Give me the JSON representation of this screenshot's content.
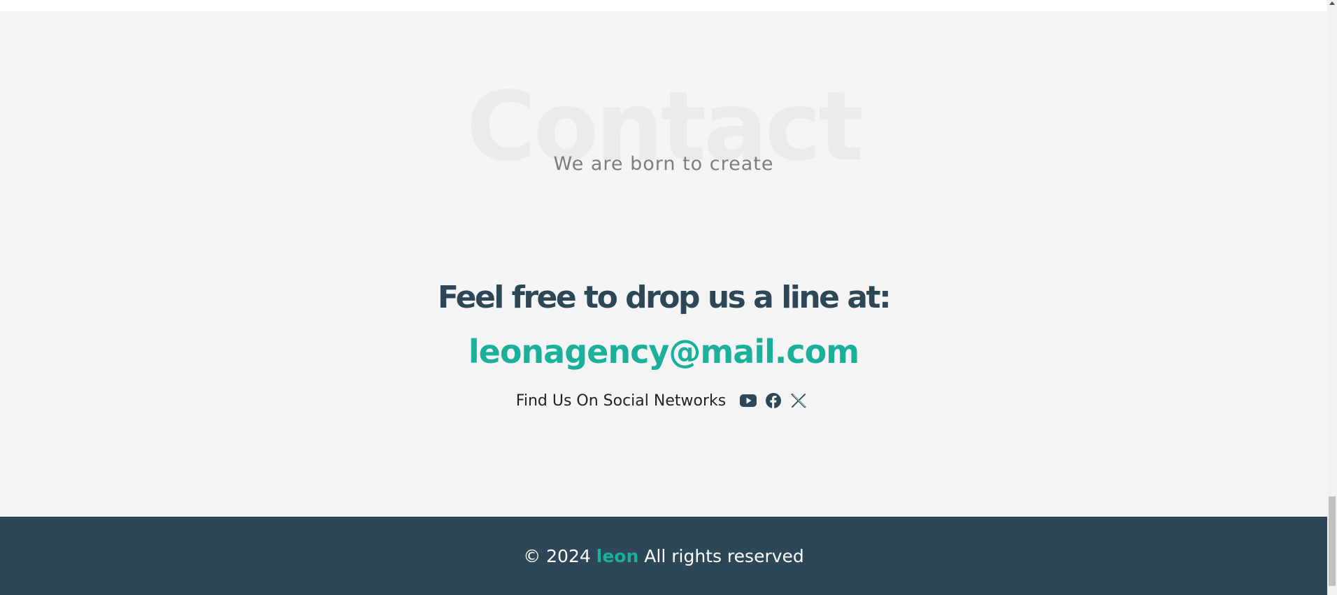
{
  "contact": {
    "background_title": "Contact",
    "subtitle": "We are born to create",
    "drop_line": "Feel free to drop us a line at:",
    "email": "leonagency@mail.com",
    "social_label": "Find Us On Social Networks",
    "social_icons": [
      "youtube-icon",
      "facebook-icon",
      "x-icon"
    ]
  },
  "footer": {
    "copyright_prefix": "© 2024",
    "brand": "leon",
    "rights": "All rights reserved"
  },
  "colors": {
    "accent": "#1ab09c",
    "dark": "#2d4756",
    "section_bg": "#f4f4f4"
  }
}
